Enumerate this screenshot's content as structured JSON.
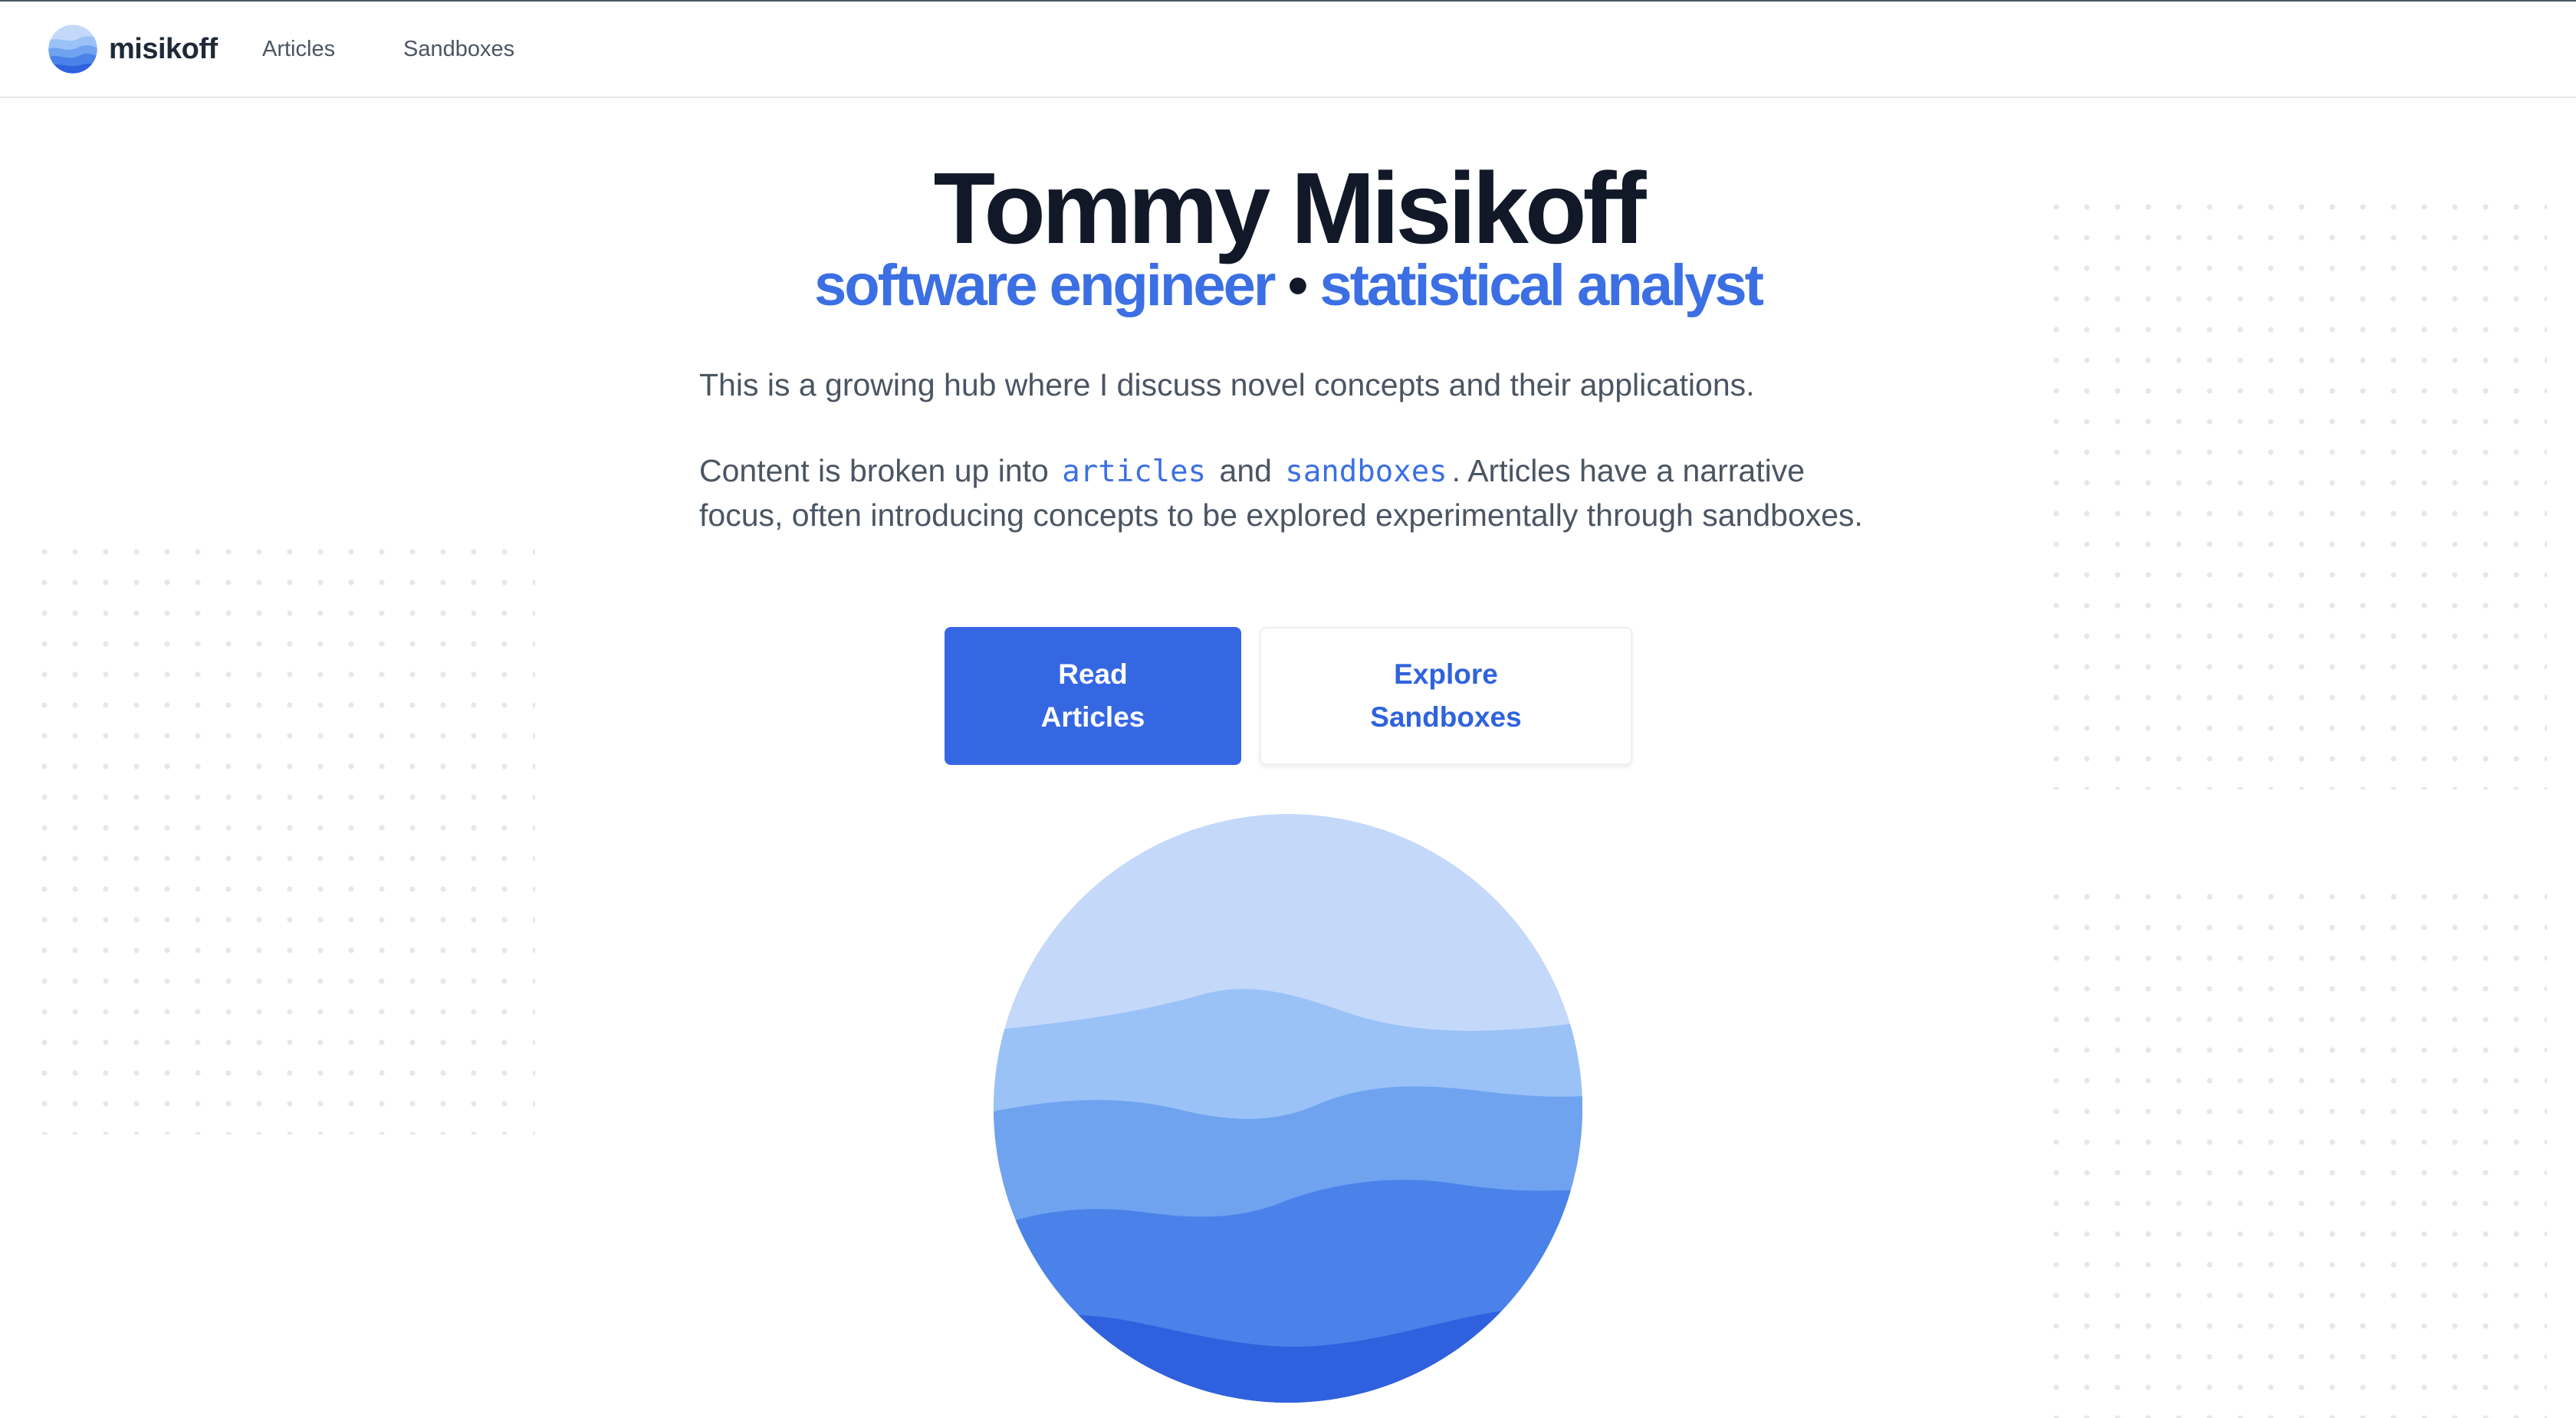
{
  "nav": {
    "brand_name": "misikoff",
    "links": [
      "Articles",
      "Sandboxes"
    ]
  },
  "hero": {
    "title": "Tommy Misikoff",
    "subtitle": {
      "role_1": "software engineer",
      "separator": "•",
      "role_2": "statistical analyst"
    },
    "intro_1": "This is a growing hub where I discuss novel concepts and their applications.",
    "intro_2": {
      "prefix": "Content is broken up into",
      "code_1": "articles",
      "middle": "and",
      "code_2": "sandboxes",
      "suffix": ". Articles have a narrative focus, often introducing concepts to be explored experimentally through sandboxes."
    }
  },
  "buttons": {
    "primary": {
      "line_1": "Read",
      "line_2": "Articles"
    },
    "secondary": {
      "line_1": "Explore",
      "line_2": "Sandboxes"
    }
  },
  "icons": {
    "brand_logo": "wave-globe-icon",
    "hero_graphic": "wave-globe-illustration"
  },
  "colors": {
    "accent": "#3567e3",
    "title": "#111827",
    "body_text": "#4b5563",
    "wave_1": "#c4d9fa",
    "wave_2": "#9ac2f7",
    "wave_3": "#6fa3f0",
    "wave_4": "#4a82ea",
    "wave_5": "#2f60dd"
  }
}
